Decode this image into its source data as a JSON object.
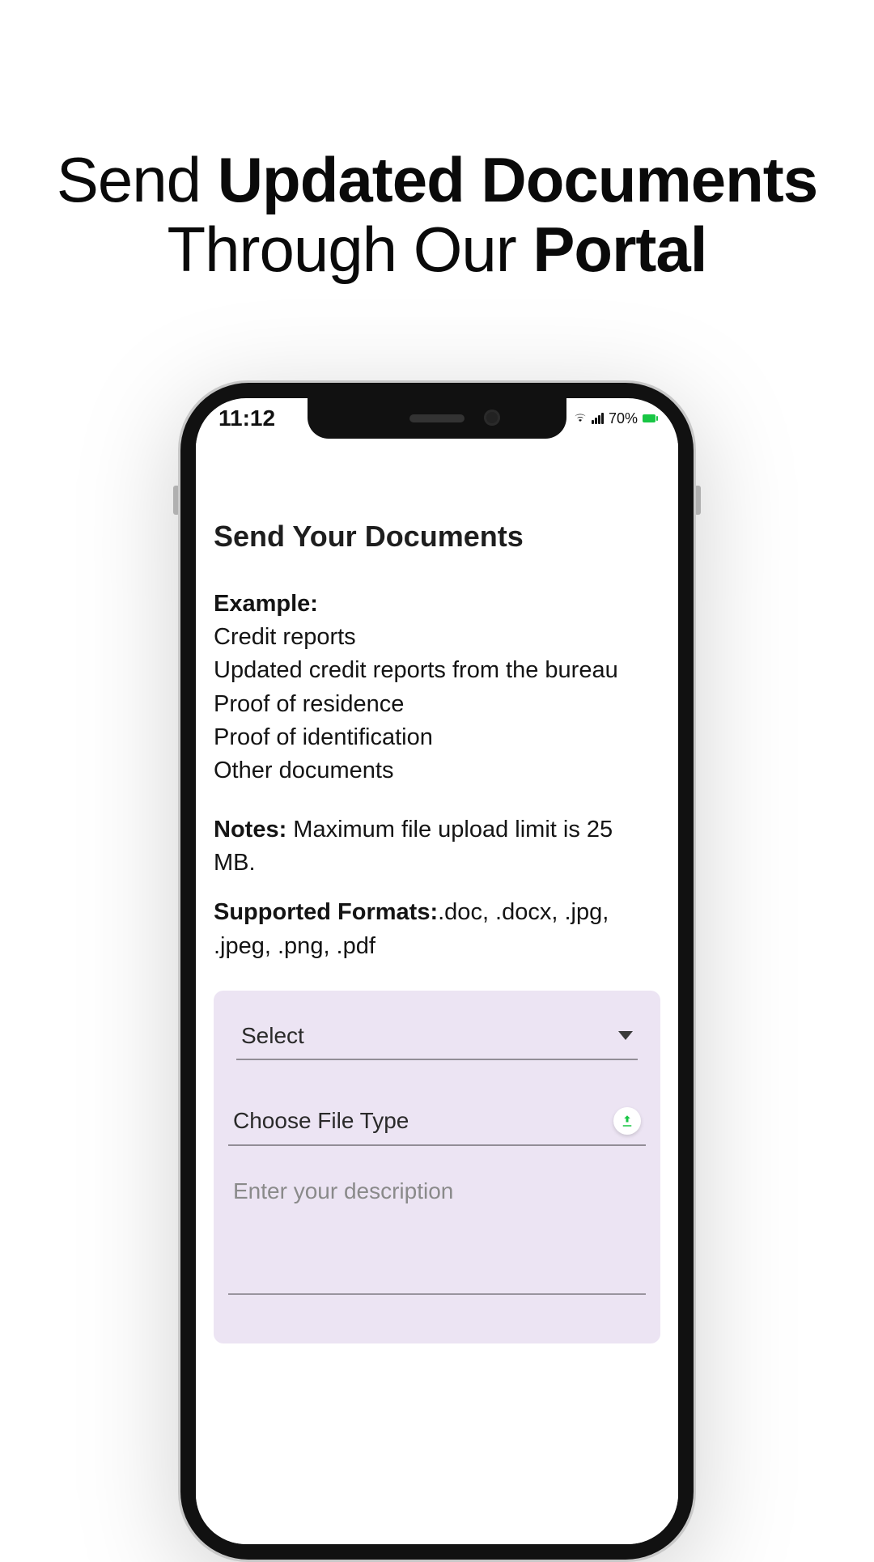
{
  "headline": {
    "l1a": "Send ",
    "l1b": "Updated Documents",
    "l2a": "Through Our ",
    "l2b": "Portal"
  },
  "status": {
    "time": "11:12",
    "battery_pct": "70%"
  },
  "app": {
    "title": "Send Your Documents",
    "example_label": "Example:",
    "examples": [
      "Credit reports",
      "Updated credit reports from the bureau",
      "Proof of residence",
      "Proof of identification",
      "Other documents"
    ],
    "notes_label": "Notes:",
    "notes_text": " Maximum file upload limit is 25 MB.",
    "formats_label": "Supported Formats:",
    "formats_text": ".doc, .docx, .jpg, .jpeg, .png, .pdf",
    "form": {
      "select_label": "Select",
      "file_type_label": "Choose File Type",
      "description_placeholder": "Enter your description"
    }
  },
  "colors": {
    "accent_green": "#18c644"
  }
}
